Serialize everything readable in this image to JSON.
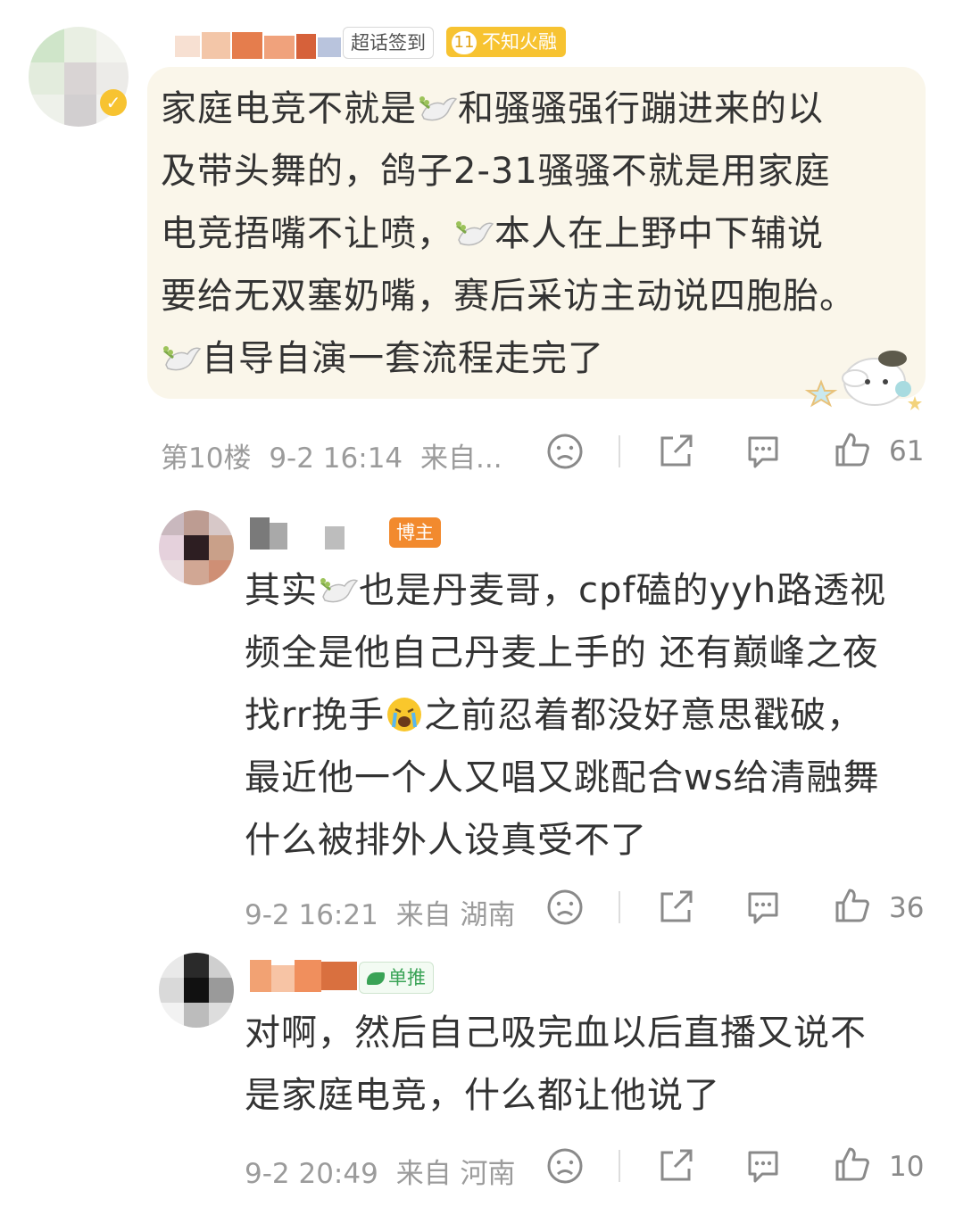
{
  "comments": [
    {
      "text_lines": [
        "家庭电竞不就是",
        "和骚骚强行蹦进来的以",
        "及带头舞的，鸽子2-31骚骚不就是用家庭",
        "电竞捂嘴不让喷，",
        "本人在上野中下辅说",
        "要给无双塞奶嘴，赛后采访主动说四胞胎。",
        "自导自演一套",
        "流程走完了"
      ],
      "badge_checkin": "超话签到",
      "badge_level": "11",
      "badge_title": "不知火融",
      "floor": "第10楼",
      "time": "9-2 16:14",
      "source": "来自...",
      "likes": "61"
    },
    {
      "text_lines": [
        "其实",
        "也是丹麦哥，cpf磕的yyh路透视",
        "频全是他自己丹麦上手的 还有巅峰之夜",
        "找rr挽手",
        "之前忍着都没好意思戳破，",
        "最近他一个人又唱又跳配合ws给清融舞",
        "什么被排外人设真受不了"
      ],
      "badge_author": "博主",
      "time": "9-2 16:21",
      "source": "来自 湖南",
      "likes": "36"
    },
    {
      "text_lines": [
        "对啊，然后自己吸完血以后直播又说不",
        "是家庭电竞，什么都让他说了"
      ],
      "badge_recommend": "单推",
      "time": "9-2 20:49",
      "source": "来自 河南",
      "likes": "10"
    }
  ],
  "icons": [
    "sad-face-icon",
    "share-icon",
    "comment-icon",
    "like-icon",
    "dove-emoji-icon",
    "crying-emoji-icon"
  ],
  "colors": {
    "bubble": "#faf6ea",
    "meta": "#9b9b9b",
    "badge_orange": "#f28a2e",
    "badge_gold": "#f7c331"
  }
}
